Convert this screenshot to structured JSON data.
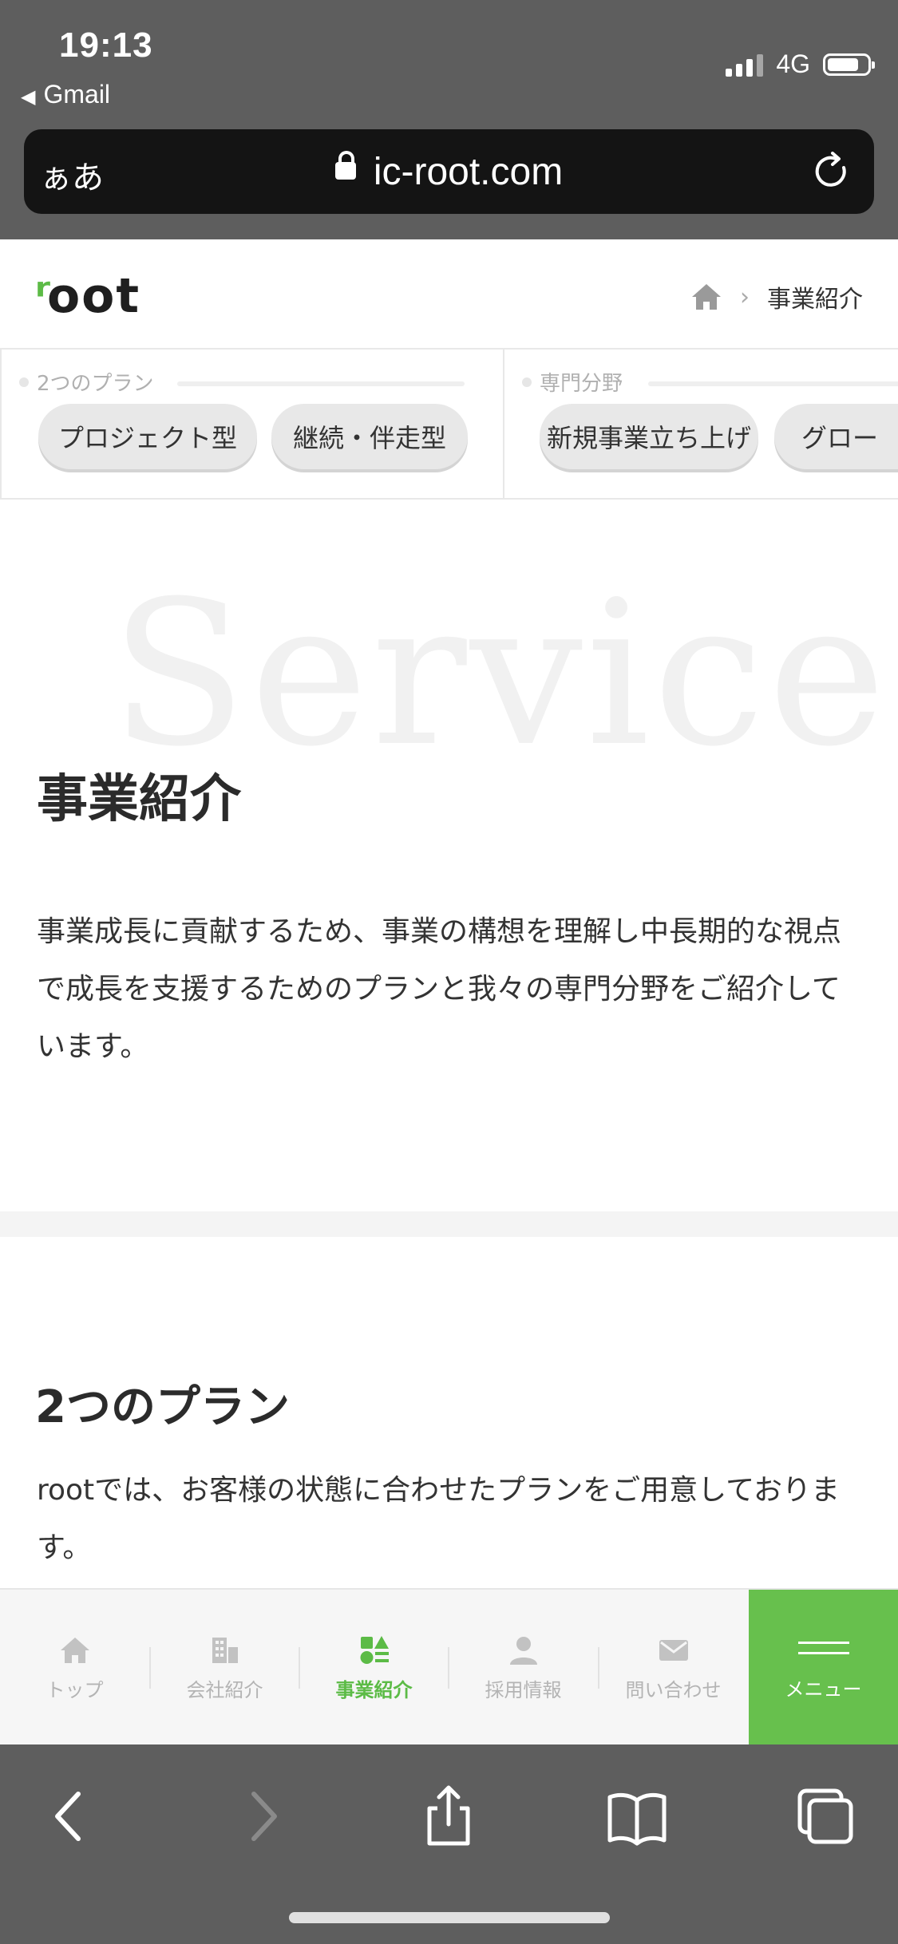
{
  "status_bar": {
    "time": "19:13",
    "back_app": "Gmail",
    "network": "4G"
  },
  "browser": {
    "text_size_button": "ぁあ",
    "url": "ic-root.com"
  },
  "header": {
    "logo": "root",
    "breadcrumb_current": "事業紹介"
  },
  "subnav": {
    "plan_group_label": "2つのプラン",
    "plan_items": [
      "プロジェクト型",
      "継続・伴走型"
    ],
    "field_group_label": "専門分野",
    "field_items": [
      "新規事業立ち上げ",
      "グロー"
    ]
  },
  "hero": {
    "background_word": "Service",
    "title": "事業紹介",
    "description": "事業成長に貢献するため、事業の構想を理解し中長期的な視点で成長を支援するためのプランと我々の専門分野をご紹介しています。"
  },
  "plans_section": {
    "title": "2つのプラン",
    "description": "rootでは、お客様の状態に合わせたプランをご用意しております。"
  },
  "bottom_nav": {
    "items": [
      {
        "label": "トップ",
        "icon": "home-icon"
      },
      {
        "label": "会社紹介",
        "icon": "building-icon"
      },
      {
        "label": "事業紹介",
        "icon": "shapes-icon"
      },
      {
        "label": "採用情報",
        "icon": "person-icon"
      },
      {
        "label": "問い合わせ",
        "icon": "mail-icon"
      }
    ],
    "menu_label": "メニュー"
  },
  "colors": {
    "brand_green": "#5cbb46",
    "menu_green": "#67c04d",
    "chrome_gray": "#5e5e5e"
  }
}
